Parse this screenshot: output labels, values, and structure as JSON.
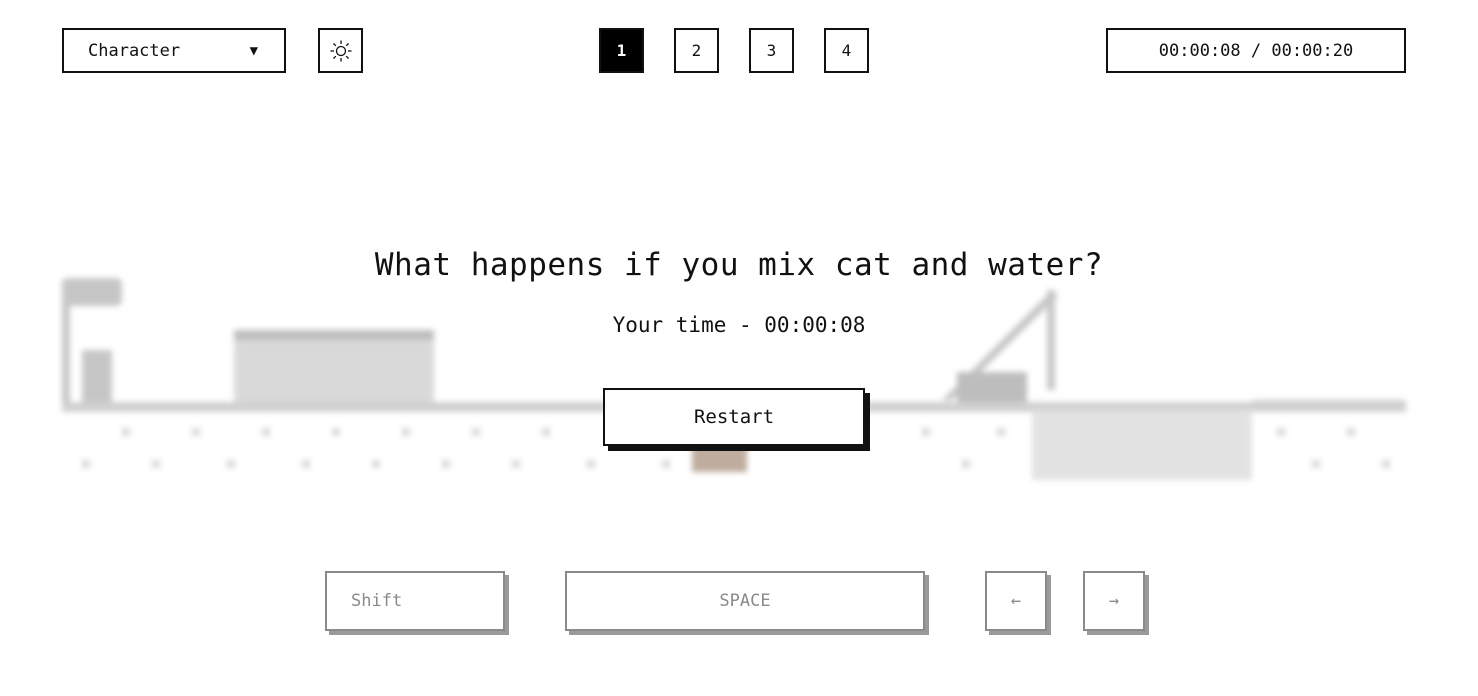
{
  "toolbar": {
    "character_label": "Character",
    "character_arrow": "▼",
    "theme_icon": "sun-icon",
    "levels": [
      "1",
      "2",
      "3",
      "4"
    ],
    "active_level": "1",
    "timer_text": "00:00:08 / 00:00:20"
  },
  "result": {
    "question": "What happens if you mix cat and water?",
    "your_time": "Your time - 00:00:08",
    "restart_label": "Restart"
  },
  "keys": {
    "shift": "Shift",
    "space": "SPACE",
    "left": "←",
    "right": "→"
  },
  "colors": {
    "text": "#111111",
    "active_level_bg": "#000000",
    "key_hint": "#8a8a8a",
    "background": "#ffffff"
  }
}
